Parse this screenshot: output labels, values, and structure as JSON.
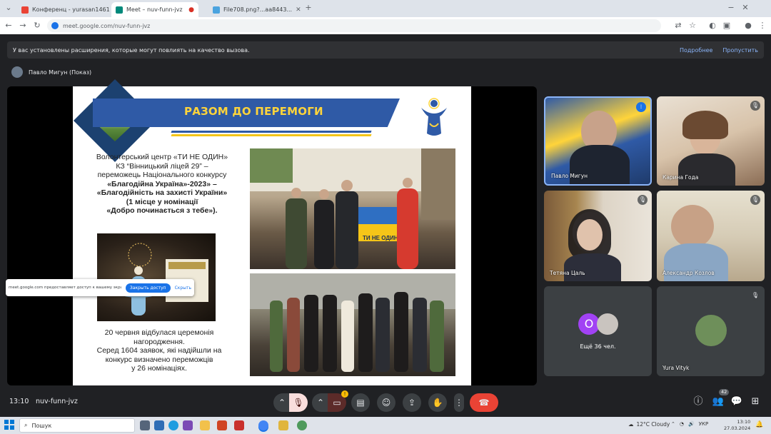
{
  "browser": {
    "tabs": [
      {
        "label": "Конференц - yurasan1461@...",
        "active": false
      },
      {
        "label": "Meet – nuv-funn-jvz",
        "active": true
      },
      {
        "label": "File708.png?...aa8443...",
        "active": false
      }
    ],
    "new_tab": "+",
    "url": "meet.google.com/nuv-funn-jvz"
  },
  "banner": {
    "text": "У вас установлены расширения, которые могут повлиять на качество вызова.",
    "details_link": "Подробнее",
    "dismiss_link": "Пропустить"
  },
  "presenter_label": "Павло Мигун (Показ)",
  "slide": {
    "title": "РАЗОМ ДО ПЕРЕМОГИ",
    "para1": {
      "line1": "Волонтерський центр «ТИ НЕ ОДИН»",
      "line2": "КЗ “Вінницький ліцей 29” –",
      "line3": "переможець Національного конкурсу",
      "line4": "«Благодійна Україна»-2023» –",
      "line5": "«Благодійність на захисті України»",
      "line6": "(1 місце у номінації",
      "line7": "«Добро починається з тебе»)."
    },
    "para2": {
      "line1": "20 червня відбулася церемонія",
      "line2": "нагородження.",
      "line3": "Серед 1604 заявок, які надійшли на",
      "line4": "конкурс визначено переможців",
      "line5": "у 26 номінаціях."
    },
    "banner_text": "ТИ НЕ ОДИН!"
  },
  "share_popup": {
    "text": "meet.google.com предоставляет доступ к вашему экрану.",
    "allow_button": "Закрыть доступ",
    "hide_button": "Скрыть"
  },
  "participants": [
    {
      "name": "Павло Мигун",
      "mic": "speaking"
    },
    {
      "name": "Карина Года",
      "mic": "muted"
    },
    {
      "name": "Тетяна Цаль",
      "mic": "muted"
    },
    {
      "name": "Александр Козлов",
      "mic": "muted"
    },
    {
      "name": "Ещё 36 чел.",
      "avatar_letter": "O",
      "avatar_color": "#a142f4"
    },
    {
      "name": "Yura Vityk",
      "mic": "muted"
    }
  ],
  "bottom_bar": {
    "time": "13:10",
    "meeting_code": "nuv-funn-jvz",
    "participants_count": "42",
    "effects_badge": "!"
  },
  "taskbar": {
    "search_placeholder": "Пошук",
    "weather": "12°C  Cloudy",
    "lang": "УКР",
    "time": "13:10",
    "date": "27.03.2024"
  },
  "colors": {
    "meet_bg": "#202124",
    "accent_blue": "#8ab4f8",
    "end_call_red": "#ea4335",
    "slide_blue": "#2f5aa6",
    "slide_yellow": "#ffd43a"
  }
}
